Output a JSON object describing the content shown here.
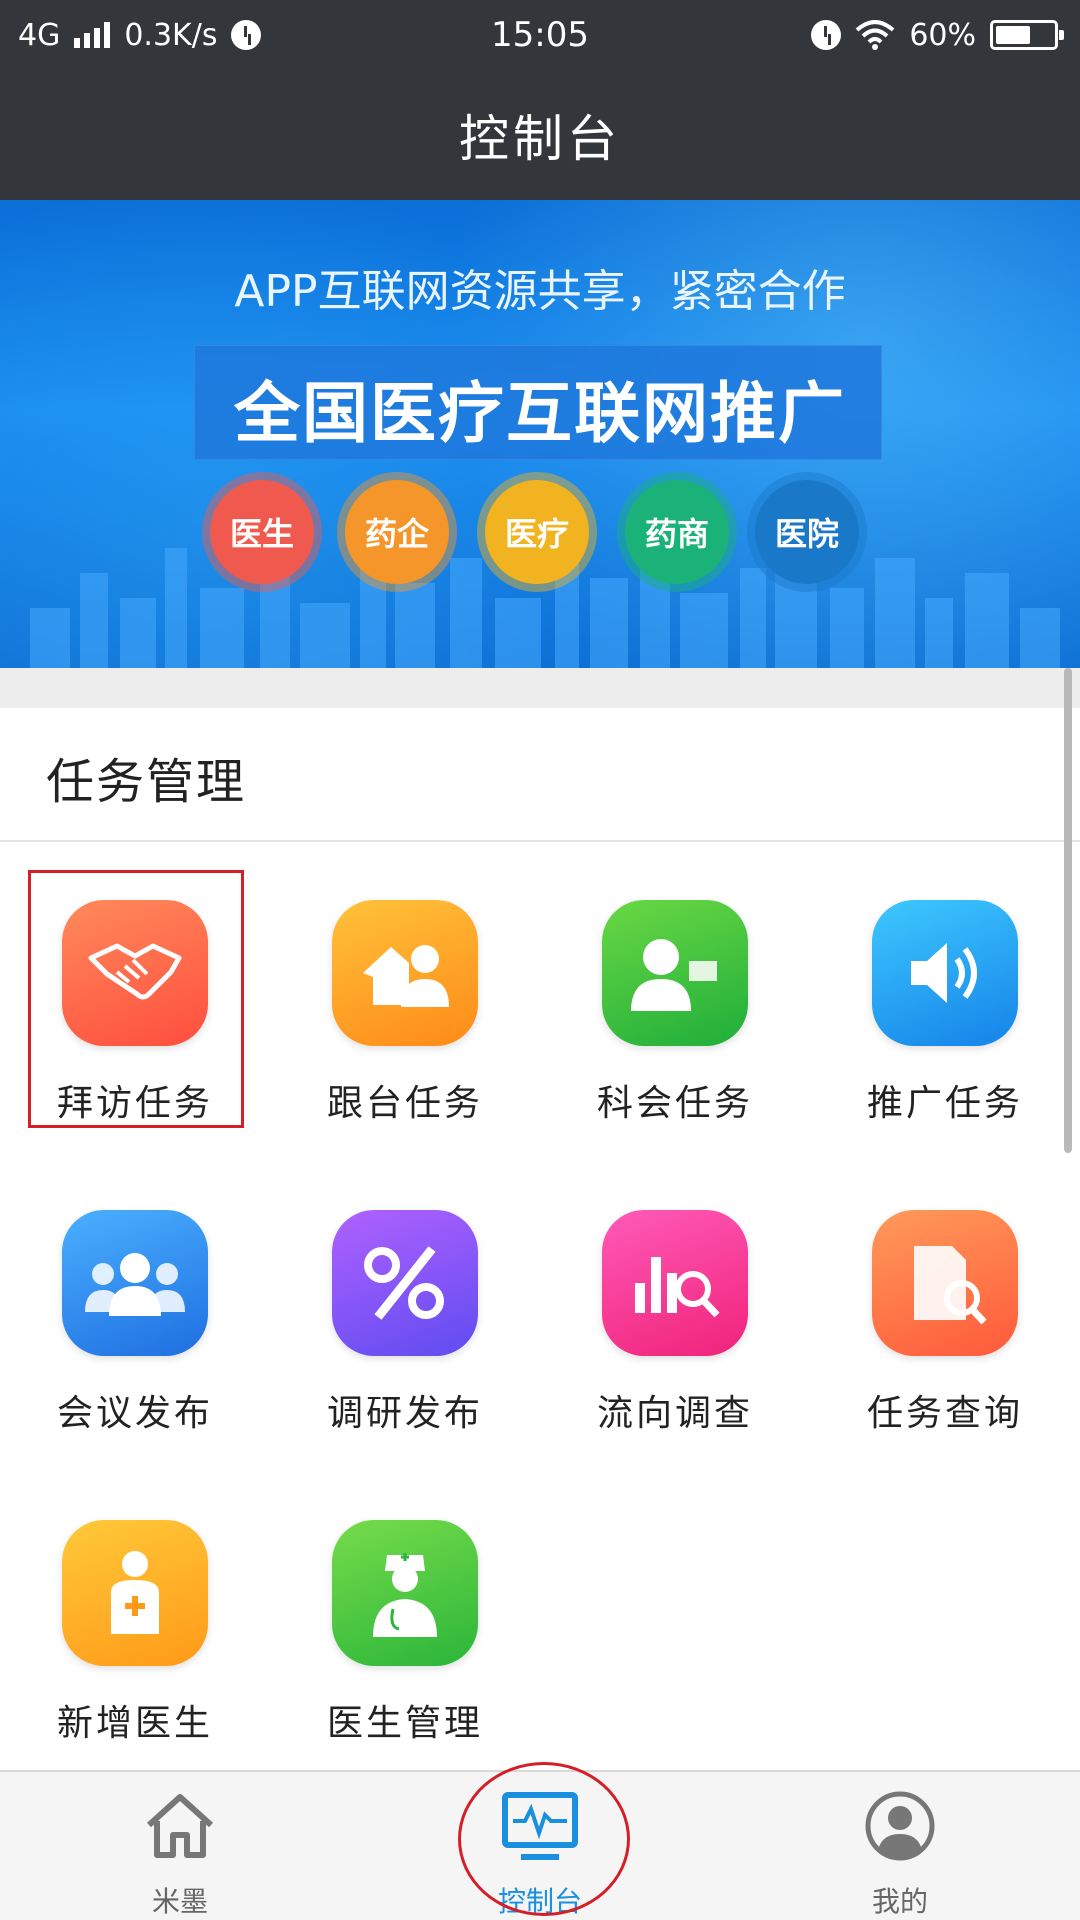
{
  "status_bar": {
    "network": "4G",
    "speed": "0.3K/s",
    "time": "15:05",
    "battery": "60%",
    "battery_level": 0.6,
    "icons": [
      "signal-icon",
      "alarm-icon",
      "wifi-icon",
      "battery-icon"
    ]
  },
  "header": {
    "title": "控制台"
  },
  "banner": {
    "line1": "APP互联网资源共享，紧密合作",
    "line2": "全国医疗互联网推广",
    "chips": [
      {
        "label": "医生",
        "color": "#f05a4e"
      },
      {
        "label": "药企",
        "color": "#f5962a"
      },
      {
        "label": "医疗",
        "color": "#f2b320"
      },
      {
        "label": "药商",
        "color": "#1bb27a"
      },
      {
        "label": "医院",
        "color": "#1a78c8"
      }
    ]
  },
  "section": {
    "title": "任务管理"
  },
  "tiles": [
    {
      "label": "拜访任务",
      "icon": "handshake-icon",
      "color_from": "#ff8a5b",
      "color_to": "#ff4e3e"
    },
    {
      "label": "跟台任务",
      "icon": "home-user-icon",
      "color_from": "#ffc23a",
      "color_to": "#ff8a18"
    },
    {
      "label": "科会任务",
      "icon": "presenter-icon",
      "color_from": "#6ad844",
      "color_to": "#1fae3a"
    },
    {
      "label": "推广任务",
      "icon": "speaker-icon",
      "color_from": "#3ec8ff",
      "color_to": "#1583e8"
    },
    {
      "label": "会议发布",
      "icon": "group-icon",
      "color_from": "#4ab0ff",
      "color_to": "#1f6fe0"
    },
    {
      "label": "调研发布",
      "icon": "percent-icon",
      "color_from": "#b061ff",
      "color_to": "#5f4cf0"
    },
    {
      "label": "流向调查",
      "icon": "chart-search-icon",
      "color_from": "#ff5ab8",
      "color_to": "#f0237a"
    },
    {
      "label": "任务查询",
      "icon": "document-search-icon",
      "color_from": "#ff9a5a",
      "color_to": "#ff5a3a"
    },
    {
      "label": "新增医生",
      "icon": "add-doctor-icon",
      "color_from": "#ffc93a",
      "color_to": "#ff9a18"
    },
    {
      "label": "医生管理",
      "icon": "nurse-icon",
      "color_from": "#76dc4a",
      "color_to": "#2bb53a"
    }
  ],
  "bottom_nav": [
    {
      "label": "米墨",
      "icon": "home-icon",
      "active": false
    },
    {
      "label": "控制台",
      "icon": "monitor-icon",
      "active": true
    },
    {
      "label": "我的",
      "icon": "profile-icon",
      "active": false
    }
  ],
  "accent_color": "#1a8fe0",
  "annotation_color": "#d41f26"
}
